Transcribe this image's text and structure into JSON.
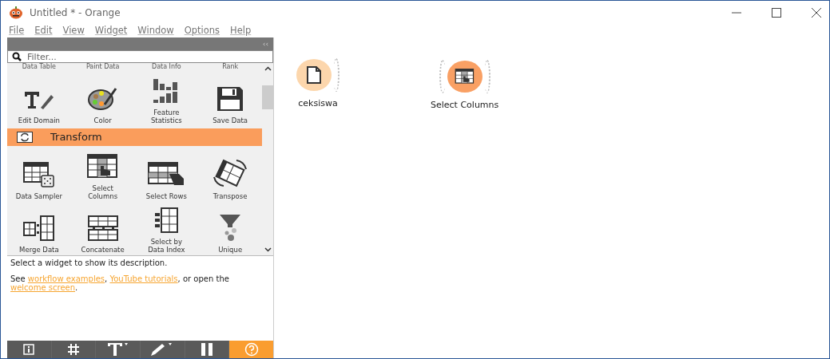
{
  "window": {
    "title": "Untitled * - Orange"
  },
  "menu": [
    {
      "label": "File"
    },
    {
      "label": "Edit"
    },
    {
      "label": "View"
    },
    {
      "label": "Widget"
    },
    {
      "label": "Window"
    },
    {
      "label": "Options"
    },
    {
      "label": "Help"
    }
  ],
  "palette": {
    "collapse": "‹‹",
    "filter": {
      "placeholder": "Filter..."
    },
    "sections": [
      {
        "kind": "widgets",
        "widgets": [
          {
            "name": "Data Table",
            "kind": "none"
          },
          {
            "name": "Paint Data",
            "kind": "none"
          },
          {
            "name": "Data Info",
            "kind": "none"
          },
          {
            "name": "Rank",
            "kind": "none"
          }
        ]
      },
      {
        "kind": "widgets",
        "widgets": [
          {
            "name": "Edit Domain",
            "kind": "text"
          },
          {
            "name": "Color",
            "kind": "palette"
          },
          {
            "name": "Feature Statistics",
            "kind": "bars"
          },
          {
            "name": "Save Data",
            "kind": "disk"
          }
        ]
      },
      {
        "kind": "header",
        "title": "Transform"
      },
      {
        "kind": "widgets",
        "widgets": [
          {
            "name": "Data Sampler",
            "kind": "dice"
          },
          {
            "name": "Select Columns",
            "kind": "columns"
          },
          {
            "name": "Select Rows",
            "kind": "rows"
          },
          {
            "name": "Transpose",
            "kind": "transpose"
          }
        ]
      },
      {
        "kind": "widgets",
        "widgets": [
          {
            "name": "Merge Data",
            "kind": "merge"
          },
          {
            "name": "Concatenate",
            "kind": "concat"
          },
          {
            "name": "Select by Data Index",
            "kind": "index"
          },
          {
            "name": "Unique",
            "kind": "funnel"
          }
        ]
      }
    ]
  },
  "description": {
    "text": "Select a widget to show its description.",
    "parts": [
      {
        "kind": "text",
        "text": "See "
      },
      {
        "kind": "link",
        "text": "workflow examples"
      },
      {
        "kind": "text",
        "text": ", "
      },
      {
        "kind": "link",
        "text": "YouTube tutorials"
      },
      {
        "kind": "text",
        "text": ", or open the "
      },
      {
        "kind": "link",
        "text": "welcome screen"
      },
      {
        "kind": "text",
        "text": "."
      }
    ]
  },
  "toolbar": [
    {
      "kind": "info",
      "selected": false
    },
    {
      "kind": "grid",
      "selected": false
    },
    {
      "kind": "text",
      "selected": false
    },
    {
      "kind": "pen",
      "selected": false
    },
    {
      "kind": "pause",
      "selected": false
    },
    {
      "kind": "help",
      "selected": true
    }
  ],
  "canvas": {
    "nodes": [
      {
        "label": "ceksiswa",
        "kind": "file",
        "selected": false,
        "inputs": false,
        "outputs": true
      },
      {
        "label": "Select Columns",
        "kind": "columns",
        "selected": true,
        "inputs": true,
        "outputs": true
      }
    ]
  }
}
